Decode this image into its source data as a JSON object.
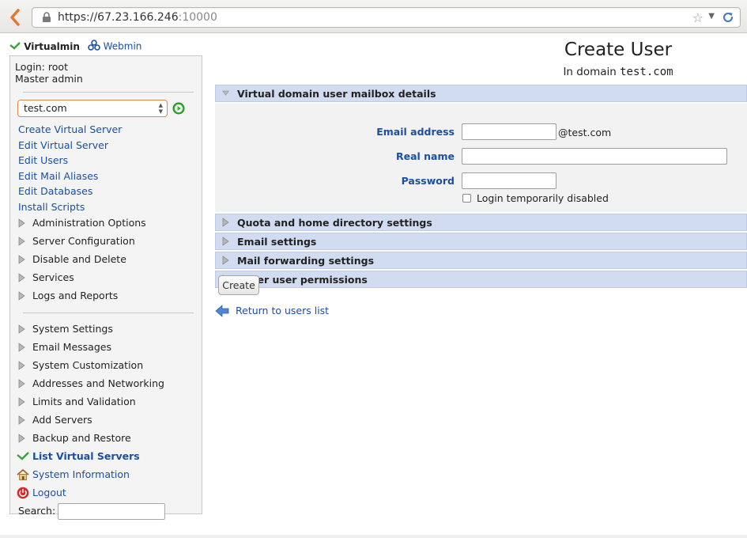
{
  "browser": {
    "url_host": "https://67.23.166.246",
    "url_port": ":10000"
  },
  "left": {
    "header": {
      "virtualmin_label": "Virtualmin",
      "webmin_label": "Webmin"
    },
    "login_line": "Login: root",
    "role_line": "Master admin",
    "domain_select": "test.com",
    "links": [
      "Create Virtual Server",
      "Edit Virtual Server",
      "Edit Users",
      "Edit Mail Aliases",
      "Edit Databases",
      "Install Scripts"
    ],
    "categories_a": [
      "Administration Options",
      "Server Configuration",
      "Disable and Delete",
      "Services",
      "Logs and Reports"
    ],
    "categories_b": [
      "System Settings",
      "Email Messages",
      "System Customization",
      "Addresses and Networking",
      "Limits and Validation",
      "Add Servers",
      "Backup and Restore"
    ],
    "list_servers": "List Virtual Servers",
    "system_info": "System Information",
    "logout": "Logout",
    "search_label": "Search:"
  },
  "main": {
    "title": "Create User",
    "subtitle_prefix": "In domain",
    "subtitle_domain": "test.com",
    "sections": {
      "mailbox": "Virtual domain user mailbox details",
      "quota": "Quota and home directory settings",
      "email": "Email settings",
      "forwarding": "Mail forwarding settings",
      "permissions": "Other user permissions"
    },
    "fields": {
      "email_label": "Email address",
      "email_value": "",
      "email_suffix": "@test.com",
      "realname_label": "Real name",
      "realname_value": "",
      "password_label": "Password",
      "password_value": "",
      "login_disabled_label": "Login temporarily disabled"
    },
    "create_button": "Create",
    "return_link": "Return to users list"
  },
  "colors": {
    "link": "#1a4fa3",
    "section_bg": "#d1dcf0",
    "virtualmin_check": "#3aa23a",
    "go_button": "#33b233",
    "select_border": "#e0874d",
    "back_arrow": "#e8772e"
  }
}
